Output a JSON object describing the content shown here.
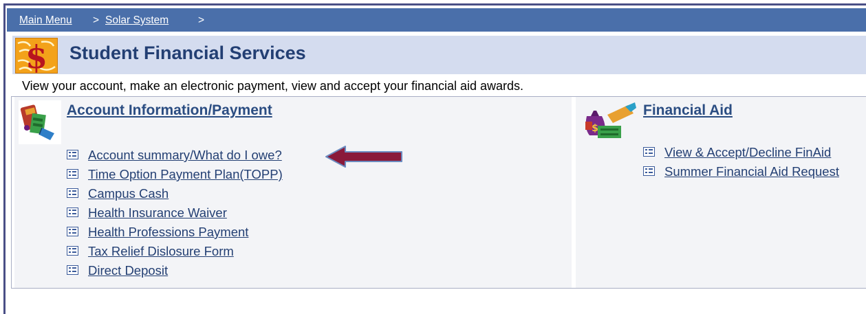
{
  "breadcrumb": {
    "items": [
      "Main Menu",
      "Solar System"
    ],
    "separator": ">"
  },
  "header": {
    "title": "Student Financial Services",
    "icon": "dollar-sign-icon"
  },
  "description": "View your account, make an electronic payment, view and accept your financial aid awards.",
  "sections": {
    "account": {
      "heading": "Account Information/Payment",
      "icon": "money-wallet-icon",
      "links": [
        "Account  summary/What do I owe?",
        "Time Option Payment Plan(TOPP)",
        "Campus Cash",
        "Health Insurance Waiver",
        "Health Professions Payment",
        "Tax Relief Dislosure Form",
        "Direct Deposit"
      ]
    },
    "financial_aid": {
      "heading": "Financial Aid",
      "icon": "money-bag-icon",
      "links": [
        "View & Accept/Decline FinAid",
        "Summer Financial Aid Request"
      ]
    }
  },
  "annotation": {
    "arrow_color": "#8a1a3a",
    "points_to": "Account  summary/What do I owe?"
  },
  "colors": {
    "breadcrumb_bar": "#4a6faa",
    "title_bar": "#d4dcef",
    "title_text": "#233f73",
    "panel_bg": "#f3f4f7"
  }
}
